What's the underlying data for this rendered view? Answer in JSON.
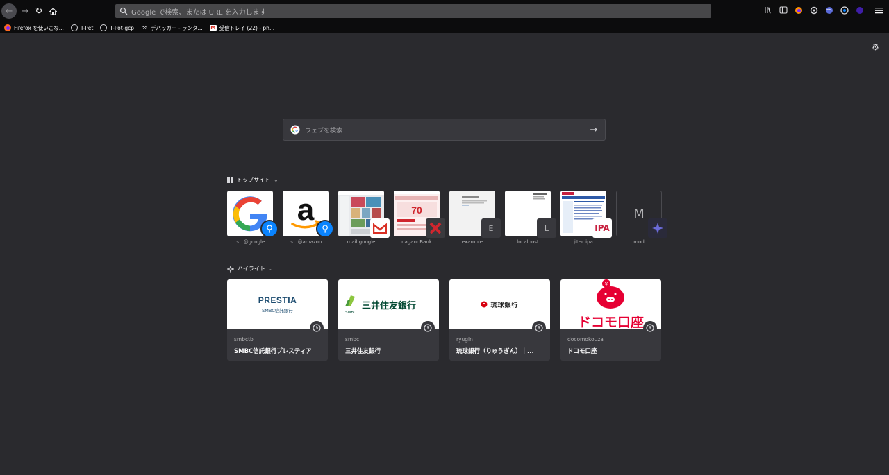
{
  "toolbar": {
    "urlbar_placeholder": "Google で検索、または URL を入力します"
  },
  "bookmarks": [
    {
      "label": "Firefox を使いこな...",
      "icon": "firefox-icon"
    },
    {
      "label": "T-Pet",
      "icon": "globe-icon"
    },
    {
      "label": "T-Pot-gcp",
      "icon": "globe-icon"
    },
    {
      "label": "デバッガー - ランタ...",
      "icon": "wrench-icon"
    },
    {
      "label": "受信トレイ (22) - ph...",
      "icon": "gmail-icon"
    }
  ],
  "search": {
    "placeholder": "ウェブを検索"
  },
  "top_sites": {
    "title": "トップサイト",
    "items": [
      {
        "label": "@google",
        "pinned": true
      },
      {
        "label": "@amazon",
        "pinned": true
      },
      {
        "label": "mail.google",
        "pinned": false
      },
      {
        "label": "naganoBank",
        "pinned": false
      },
      {
        "label": "example",
        "pinned": false,
        "letter": "E"
      },
      {
        "label": "localhost",
        "pinned": false,
        "letter": "L"
      },
      {
        "label": "jitec.ipa",
        "pinned": false
      },
      {
        "label": "mod",
        "pinned": false,
        "letter": "M"
      }
    ]
  },
  "highlights": {
    "title": "ハイライト",
    "items": [
      {
        "host": "smbctb",
        "title": "SMBC信託銀行プレスティア",
        "logo_main": "PRESTIA",
        "logo_sub": "SMBC信託銀行"
      },
      {
        "host": "smbc",
        "title": "三井住友銀行",
        "logo_main": "三井住友銀行",
        "logo_sub": "SMBC"
      },
      {
        "host": "ryugin",
        "title": "琉球銀行（りゅうぎん）｜...",
        "logo_main": "琉球銀行"
      },
      {
        "host": "docomokouza",
        "title": "ドコモ口座",
        "logo_main": "ドコモ口座"
      }
    ]
  },
  "colors": {
    "background": "#2a2a2e",
    "toolbar": "#0c0c0d",
    "accent_blue": "#0a84ff",
    "card": "#38383d"
  }
}
